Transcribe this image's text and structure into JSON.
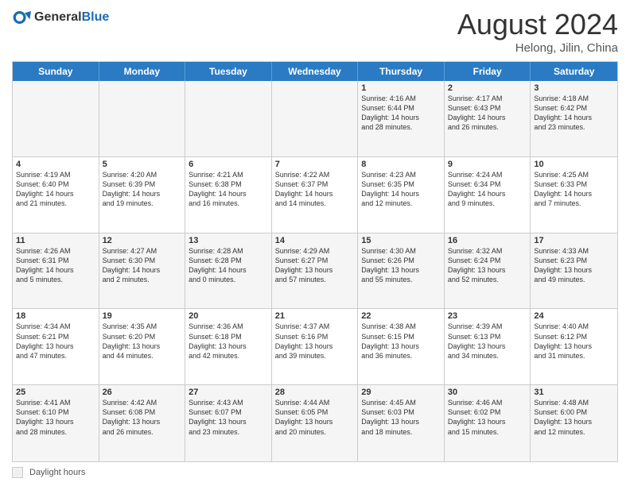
{
  "header": {
    "logo_general": "General",
    "logo_blue": "Blue",
    "month_title": "August 2024",
    "subtitle": "Helong, Jilin, China"
  },
  "days_of_week": [
    "Sunday",
    "Monday",
    "Tuesday",
    "Wednesday",
    "Thursday",
    "Friday",
    "Saturday"
  ],
  "footer": {
    "legend_label": "Daylight hours"
  },
  "weeks": [
    {
      "cells": [
        {
          "day": "",
          "info": ""
        },
        {
          "day": "",
          "info": ""
        },
        {
          "day": "",
          "info": ""
        },
        {
          "day": "",
          "info": ""
        },
        {
          "day": "1",
          "info": "Sunrise: 4:16 AM\nSunset: 6:44 PM\nDaylight: 14 hours\nand 28 minutes."
        },
        {
          "day": "2",
          "info": "Sunrise: 4:17 AM\nSunset: 6:43 PM\nDaylight: 14 hours\nand 26 minutes."
        },
        {
          "day": "3",
          "info": "Sunrise: 4:18 AM\nSunset: 6:42 PM\nDaylight: 14 hours\nand 23 minutes."
        }
      ]
    },
    {
      "cells": [
        {
          "day": "4",
          "info": "Sunrise: 4:19 AM\nSunset: 6:40 PM\nDaylight: 14 hours\nand 21 minutes."
        },
        {
          "day": "5",
          "info": "Sunrise: 4:20 AM\nSunset: 6:39 PM\nDaylight: 14 hours\nand 19 minutes."
        },
        {
          "day": "6",
          "info": "Sunrise: 4:21 AM\nSunset: 6:38 PM\nDaylight: 14 hours\nand 16 minutes."
        },
        {
          "day": "7",
          "info": "Sunrise: 4:22 AM\nSunset: 6:37 PM\nDaylight: 14 hours\nand 14 minutes."
        },
        {
          "day": "8",
          "info": "Sunrise: 4:23 AM\nSunset: 6:35 PM\nDaylight: 14 hours\nand 12 minutes."
        },
        {
          "day": "9",
          "info": "Sunrise: 4:24 AM\nSunset: 6:34 PM\nDaylight: 14 hours\nand 9 minutes."
        },
        {
          "day": "10",
          "info": "Sunrise: 4:25 AM\nSunset: 6:33 PM\nDaylight: 14 hours\nand 7 minutes."
        }
      ]
    },
    {
      "cells": [
        {
          "day": "11",
          "info": "Sunrise: 4:26 AM\nSunset: 6:31 PM\nDaylight: 14 hours\nand 5 minutes."
        },
        {
          "day": "12",
          "info": "Sunrise: 4:27 AM\nSunset: 6:30 PM\nDaylight: 14 hours\nand 2 minutes."
        },
        {
          "day": "13",
          "info": "Sunrise: 4:28 AM\nSunset: 6:28 PM\nDaylight: 14 hours\nand 0 minutes."
        },
        {
          "day": "14",
          "info": "Sunrise: 4:29 AM\nSunset: 6:27 PM\nDaylight: 13 hours\nand 57 minutes."
        },
        {
          "day": "15",
          "info": "Sunrise: 4:30 AM\nSunset: 6:26 PM\nDaylight: 13 hours\nand 55 minutes."
        },
        {
          "day": "16",
          "info": "Sunrise: 4:32 AM\nSunset: 6:24 PM\nDaylight: 13 hours\nand 52 minutes."
        },
        {
          "day": "17",
          "info": "Sunrise: 4:33 AM\nSunset: 6:23 PM\nDaylight: 13 hours\nand 49 minutes."
        }
      ]
    },
    {
      "cells": [
        {
          "day": "18",
          "info": "Sunrise: 4:34 AM\nSunset: 6:21 PM\nDaylight: 13 hours\nand 47 minutes."
        },
        {
          "day": "19",
          "info": "Sunrise: 4:35 AM\nSunset: 6:20 PM\nDaylight: 13 hours\nand 44 minutes."
        },
        {
          "day": "20",
          "info": "Sunrise: 4:36 AM\nSunset: 6:18 PM\nDaylight: 13 hours\nand 42 minutes."
        },
        {
          "day": "21",
          "info": "Sunrise: 4:37 AM\nSunset: 6:16 PM\nDaylight: 13 hours\nand 39 minutes."
        },
        {
          "day": "22",
          "info": "Sunrise: 4:38 AM\nSunset: 6:15 PM\nDaylight: 13 hours\nand 36 minutes."
        },
        {
          "day": "23",
          "info": "Sunrise: 4:39 AM\nSunset: 6:13 PM\nDaylight: 13 hours\nand 34 minutes."
        },
        {
          "day": "24",
          "info": "Sunrise: 4:40 AM\nSunset: 6:12 PM\nDaylight: 13 hours\nand 31 minutes."
        }
      ]
    },
    {
      "cells": [
        {
          "day": "25",
          "info": "Sunrise: 4:41 AM\nSunset: 6:10 PM\nDaylight: 13 hours\nand 28 minutes."
        },
        {
          "day": "26",
          "info": "Sunrise: 4:42 AM\nSunset: 6:08 PM\nDaylight: 13 hours\nand 26 minutes."
        },
        {
          "day": "27",
          "info": "Sunrise: 4:43 AM\nSunset: 6:07 PM\nDaylight: 13 hours\nand 23 minutes."
        },
        {
          "day": "28",
          "info": "Sunrise: 4:44 AM\nSunset: 6:05 PM\nDaylight: 13 hours\nand 20 minutes."
        },
        {
          "day": "29",
          "info": "Sunrise: 4:45 AM\nSunset: 6:03 PM\nDaylight: 13 hours\nand 18 minutes."
        },
        {
          "day": "30",
          "info": "Sunrise: 4:46 AM\nSunset: 6:02 PM\nDaylight: 13 hours\nand 15 minutes."
        },
        {
          "day": "31",
          "info": "Sunrise: 4:48 AM\nSunset: 6:00 PM\nDaylight: 13 hours\nand 12 minutes."
        }
      ]
    }
  ]
}
